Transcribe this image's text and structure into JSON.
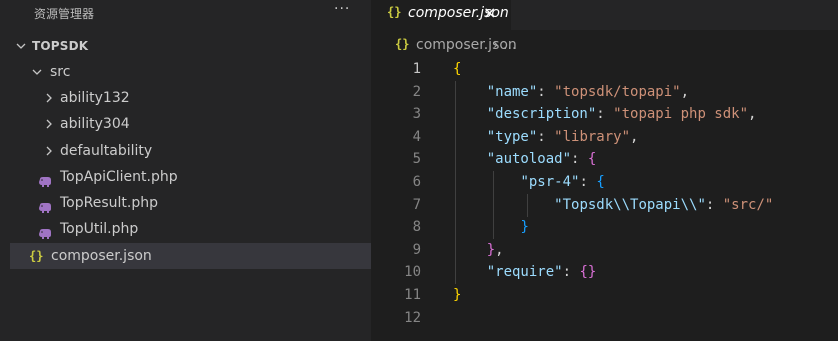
{
  "sidebar": {
    "title": "资源管理器",
    "more_label": "···",
    "root": "TOPSDK",
    "items": [
      {
        "label": "src"
      },
      {
        "label": "ability132"
      },
      {
        "label": "ability304"
      },
      {
        "label": "defaultability"
      },
      {
        "label": "TopApiClient.php"
      },
      {
        "label": "TopResult.php"
      },
      {
        "label": "TopUtil.php"
      },
      {
        "label": "composer.json"
      }
    ]
  },
  "editor": {
    "tab": {
      "icon": "{}",
      "label": "composer.json",
      "close": "×"
    },
    "breadcrumb": {
      "icon": "{}",
      "file": "composer.json",
      "sep": "› ..."
    },
    "line_numbers": [
      "1",
      "2",
      "3",
      "4",
      "5",
      "6",
      "7",
      "8",
      "9",
      "10",
      "11",
      "12"
    ],
    "code": {
      "open_brace": "{",
      "name_key": "\"name\"",
      "name_val": "\"topsdk/topapi\"",
      "desc_key": "\"description\"",
      "desc_val": "\"topapi php sdk\"",
      "type_key": "\"type\"",
      "type_val": "\"library\"",
      "autoload_key": "\"autoload\"",
      "psr_key": "\"psr-4\"",
      "ns_key": "\"Topsdk\\\\Topapi\\\\\"",
      "ns_val": "\"src/\"",
      "require_key": "\"require\"",
      "close_brace": "}"
    }
  },
  "colors": {
    "json_icon": "#cbcb41",
    "php_icon": "#a074c4",
    "key": "#9cdcfe",
    "string": "#ce9178"
  }
}
